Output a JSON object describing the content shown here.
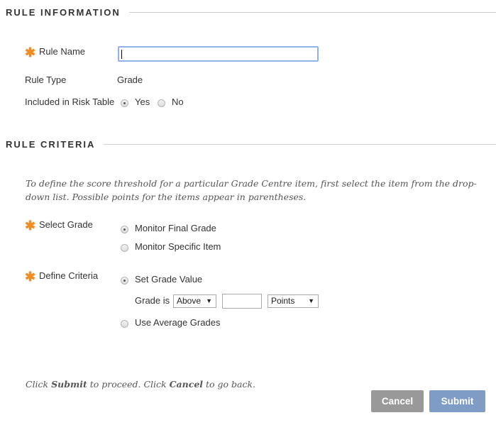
{
  "rule_information": {
    "title": "RULE INFORMATION",
    "rule_name": {
      "label": "Rule Name",
      "value": "",
      "required": true
    },
    "rule_type": {
      "label": "Rule Type",
      "value": "Grade"
    },
    "risk_table": {
      "label": "Included in Risk Table",
      "options": [
        "Yes",
        "No"
      ],
      "selected": "Yes"
    }
  },
  "rule_criteria": {
    "title": "RULE CRITERIA",
    "instructions": "To define the score threshold for a particular Grade Centre item, first select the item from the drop-down list. Possible points for the items appear in parentheses.",
    "select_grade": {
      "label": "Select Grade",
      "required": true,
      "options": [
        "Monitor Final Grade",
        "Monitor Specific Item"
      ],
      "selected": "Monitor Final Grade"
    },
    "define_criteria": {
      "label": "Define Criteria",
      "required": true,
      "options": [
        "Set Grade Value",
        "Use Average Grades"
      ],
      "selected": "Set Grade Value",
      "grade_is_label": "Grade is",
      "comparison": "Above",
      "value": "",
      "unit": "Points"
    }
  },
  "footer": {
    "prefix": "Click ",
    "submit_word": "Submit",
    "middle": " to proceed. Click ",
    "cancel_word": "Cancel",
    "suffix": " to go back.",
    "cancel_label": "Cancel",
    "submit_label": "Submit"
  },
  "colors": {
    "required": "#f28c1e",
    "submit": "#7f9cc6",
    "cancel": "#999999",
    "focus": "#8fb2e8"
  }
}
